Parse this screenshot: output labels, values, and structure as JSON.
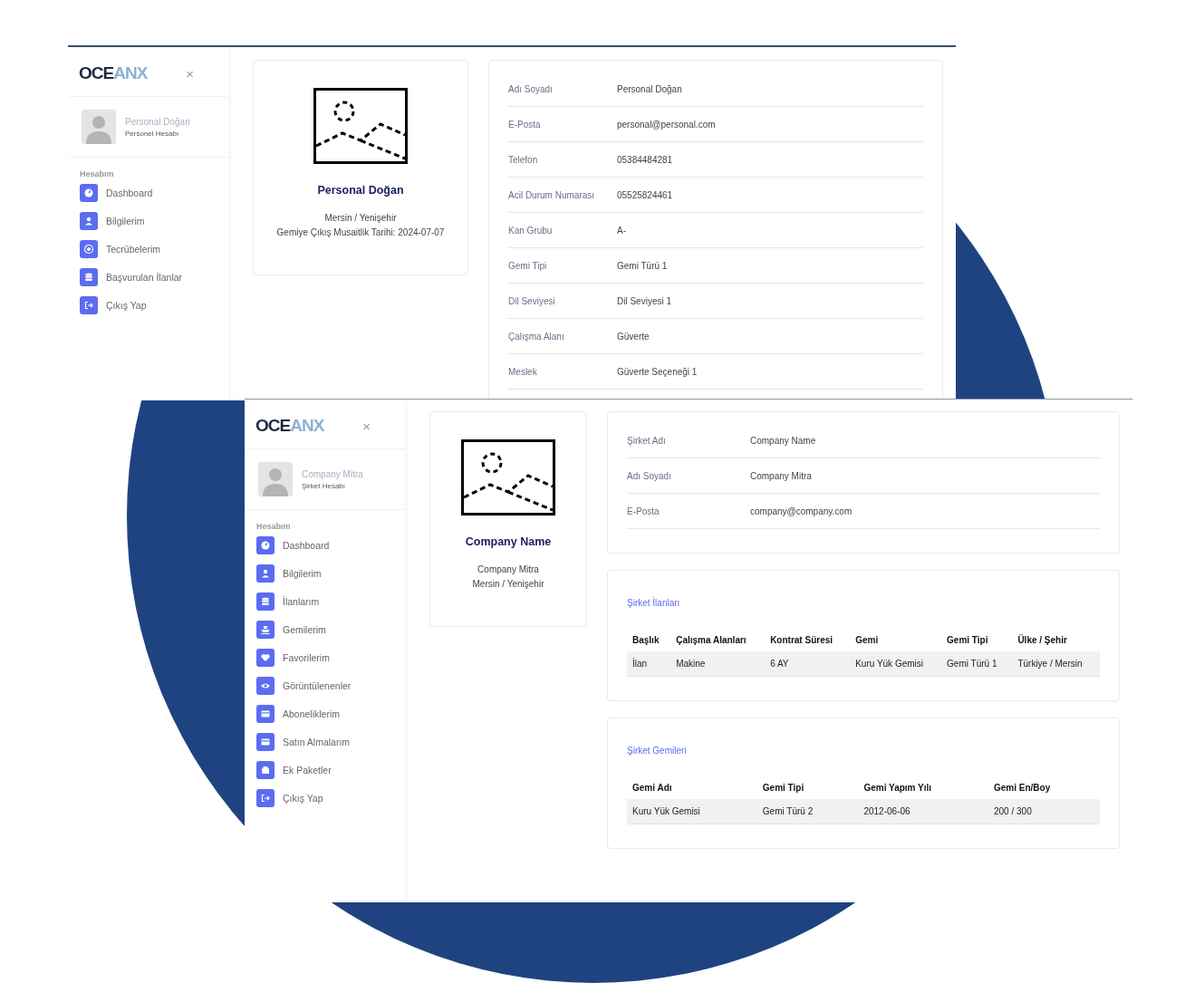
{
  "screens": [
    {
      "sidebar": {
        "logo": {
          "dark": "OCE",
          "light": "ANX"
        },
        "close": "×",
        "user": {
          "name": "Personal Doğan",
          "role": "Personel Hesabı"
        },
        "section": "Hesabım",
        "items": [
          {
            "label": "Dashboard",
            "kind": "gauge"
          },
          {
            "label": "Bilgilerim",
            "kind": "user"
          },
          {
            "label": "Tecrübelerim",
            "kind": "target"
          },
          {
            "label": "Başvurulan İlanlar",
            "kind": "database"
          },
          {
            "label": "Çıkış Yap",
            "kind": "logout"
          }
        ]
      },
      "profile": {
        "name": "Personal Doğan",
        "lines": [
          "Mersin / Yenişehir",
          "Gemiye Çıkış Musaitlik Tarihi: 2024-07-07"
        ]
      },
      "details": [
        {
          "label": "Adı Soyadı",
          "value": "Personal Doğan"
        },
        {
          "label": "E-Posta",
          "value": "personal@personal.com"
        },
        {
          "label": "Telefon",
          "value": "05384484281"
        },
        {
          "label": "Acil Durum Numarası",
          "value": "05525824461"
        },
        {
          "label": "Kan Grubu",
          "value": "A-"
        },
        {
          "label": "Gemi Tipi",
          "value": "Gemi Türü 1"
        },
        {
          "label": "Dil Seviyesi",
          "value": "Dil Seviyesi 1"
        },
        {
          "label": "Çalışma Alanı",
          "value": "Güverte"
        },
        {
          "label": "Meslek",
          "value": "Güverte Seçeneği 1"
        }
      ]
    },
    {
      "sidebar": {
        "logo": {
          "dark": "OCE",
          "light": "ANX"
        },
        "close": "×",
        "user": {
          "name": "Company Mitra",
          "role": "Şirket Hesabı"
        },
        "section": "Hesabım",
        "items": [
          {
            "label": "Dashboard",
            "kind": "gauge"
          },
          {
            "label": "Bilgilerim",
            "kind": "user"
          },
          {
            "label": "İlanlarım",
            "kind": "database"
          },
          {
            "label": "Gemilerim",
            "kind": "ship"
          },
          {
            "label": "Favorilerim",
            "kind": "heart"
          },
          {
            "label": "Görüntülenenler",
            "kind": "eye"
          },
          {
            "label": "Aboneliklerim",
            "kind": "card"
          },
          {
            "label": "Satın Almalarım",
            "kind": "card"
          },
          {
            "label": "Ek Paketler",
            "kind": "box"
          },
          {
            "label": "Çıkış Yap",
            "kind": "logout"
          }
        ]
      },
      "profile": {
        "name": "Company Name",
        "lines": [
          "Company Mitra",
          "Mersin / Yenişehir"
        ]
      },
      "details": [
        {
          "label": "Şirket Adı",
          "value": "Company Name"
        },
        {
          "label": "Adı Soyadı",
          "value": "Company Mitra"
        },
        {
          "label": "E-Posta",
          "value": "company@company.com"
        }
      ],
      "tables": [
        {
          "title": "Şirket İlanları",
          "columns": [
            "Başlık",
            "Çalışma Alanları",
            "Kontrat Süresi",
            "Gemi",
            "Gemi Tipi",
            "Ülke / Şehir"
          ],
          "rows": [
            [
              "İlan",
              "Makine",
              "6 AY",
              "Kuru Yük Gemisi",
              "Gemi Türü 1",
              "Türkiye / Mersin"
            ]
          ]
        },
        {
          "title": "Şirket Gemileri",
          "columns": [
            "Gemi Adı",
            "Gemi Tipi",
            "Gemi Yapım Yılı",
            "Gemi En/Boy"
          ],
          "rows": [
            [
              "Kuru Yük Gemisi",
              "Gemi Türü 2",
              "2012-06-06",
              "200 / 300"
            ]
          ]
        }
      ]
    }
  ]
}
